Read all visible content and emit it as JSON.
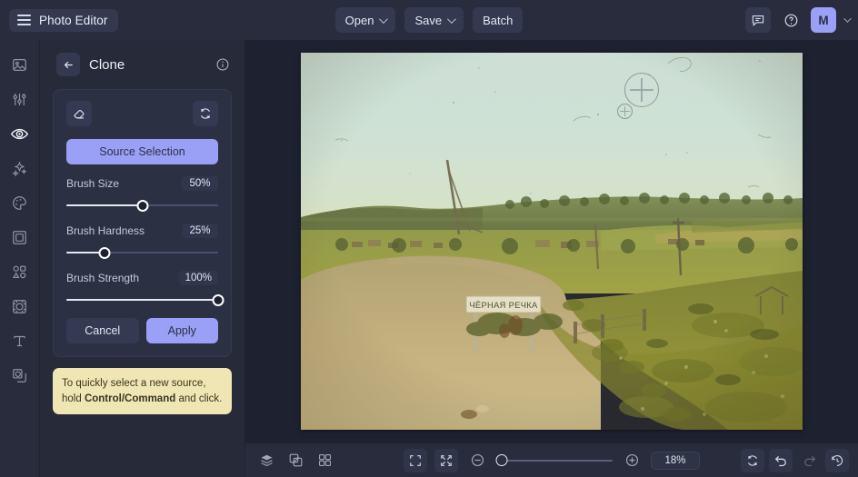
{
  "app": {
    "title": "Photo Editor",
    "accent": "#9aa0f5",
    "bg": "#1e2130",
    "panel_bg": "#262a39",
    "tip_bg": "#f0e6b4"
  },
  "topbar": {
    "menu_icon": "hamburger-icon",
    "buttons": [
      {
        "label": "Open",
        "has_chevron": true
      },
      {
        "label": "Save",
        "has_chevron": true
      },
      {
        "label": "Batch",
        "has_chevron": false
      }
    ],
    "right": {
      "feedback_icon": "chat-bubble-icon",
      "help_icon": "question-circle-icon",
      "avatar_initial": "M",
      "avatar_chevron_icon": "chevron-down-icon"
    }
  },
  "sidebar": {
    "items": [
      {
        "name": "image",
        "icon": "image-icon",
        "active": false
      },
      {
        "name": "adjust",
        "icon": "sliders-icon",
        "active": false
      },
      {
        "name": "retouch",
        "icon": "eye-icon",
        "active": true
      },
      {
        "name": "magic",
        "icon": "sparkles-icon",
        "active": false
      },
      {
        "name": "color",
        "icon": "palette-icon",
        "active": false
      },
      {
        "name": "crop",
        "icon": "frame-icon",
        "active": false
      },
      {
        "name": "shapes",
        "icon": "shapes-icon",
        "active": false
      },
      {
        "name": "effects",
        "icon": "effects-icon",
        "active": false
      },
      {
        "name": "text",
        "icon": "text-icon",
        "active": false
      },
      {
        "name": "clone",
        "icon": "clone-stamp-icon",
        "active": false
      }
    ]
  },
  "panel": {
    "back_icon": "arrow-left-icon",
    "title": "Clone",
    "info_icon": "info-circle-icon",
    "tool_icons": {
      "eraser": "eraser-icon",
      "reset": "reset-refresh-icon"
    },
    "source_selection_label": "Source Selection",
    "sliders": [
      {
        "label": "Brush Size",
        "value": "50%",
        "percent": 50
      },
      {
        "label": "Brush Hardness",
        "value": "25%",
        "percent": 25
      },
      {
        "label": "Brush Strength",
        "value": "100%",
        "percent": 100
      }
    ],
    "cancel_label": "Cancel",
    "apply_label": "Apply",
    "tip": {
      "prefix": "To quickly select a new source, hold ",
      "bold": "Control/Command",
      "suffix": " and click."
    }
  },
  "canvas": {
    "photo_alt": "vintage-landscape-photo",
    "sign_text": "ЧЁРНАЯ РЕЧКА",
    "cursor": {
      "brush_icon": "clone-brush-crosshair-icon",
      "source_icon": "clone-source-crosshair-icon"
    }
  },
  "bottombar": {
    "left_icons": [
      {
        "name": "layers-icon",
        "boxed": false,
        "dim": false
      },
      {
        "name": "compare-split-icon",
        "boxed": false,
        "dim": false
      },
      {
        "name": "grid-view-icon",
        "boxed": false,
        "dim": false
      }
    ],
    "view_icons": [
      {
        "name": "fullscreen-icon",
        "boxed": true,
        "dim": false
      },
      {
        "name": "fit-to-screen-icon",
        "boxed": true,
        "dim": false
      }
    ],
    "zoom_out_icon": "zoom-out-icon",
    "zoom_in_icon": "zoom-in-icon",
    "zoom_value": "18%",
    "zoom_percent": 5,
    "right_icons": [
      {
        "name": "reset-view-icon",
        "boxed": true,
        "dim": false
      },
      {
        "name": "undo-icon",
        "boxed": true,
        "dim": false
      },
      {
        "name": "redo-icon",
        "boxed": false,
        "dim": true
      },
      {
        "name": "history-icon",
        "boxed": true,
        "dim": false
      }
    ]
  }
}
